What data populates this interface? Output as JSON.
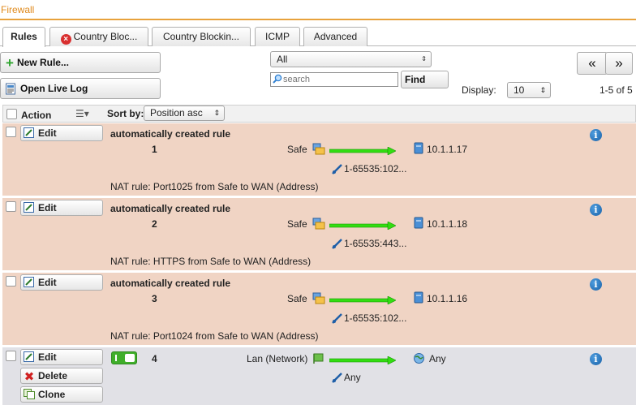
{
  "title": "Firewall",
  "tabs": [
    {
      "label": "Rules"
    },
    {
      "label": "Country Bloc..."
    },
    {
      "label": "Country Blockin..."
    },
    {
      "label": "ICMP"
    },
    {
      "label": "Advanced"
    }
  ],
  "toolbar": {
    "new_rule": "New Rule...",
    "open_live_log": "Open Live Log",
    "filter_value": "All",
    "search_placeholder": "search",
    "find": "Find",
    "display_label": "Display:",
    "display_value": "10",
    "pagination": "1-5 of 5",
    "prev": "«",
    "next": "»"
  },
  "table": {
    "action_header": "Action",
    "sort_label": "Sort by:",
    "sort_value": "Position asc"
  },
  "rules": [
    {
      "edit": "Edit",
      "title": "automatically created rule",
      "position": "1",
      "source": "Safe",
      "destination": "10.1.1.17",
      "service": "1-65535:102...",
      "note": "NAT rule: Port1025 from Safe to WAN (Address)"
    },
    {
      "edit": "Edit",
      "title": "automatically created rule",
      "position": "2",
      "source": "Safe",
      "destination": "10.1.1.18",
      "service": "1-65535:443...",
      "note": "NAT rule: HTTPS from Safe to WAN (Address)"
    },
    {
      "edit": "Edit",
      "title": "automatically created rule",
      "position": "3",
      "source": "Safe",
      "destination": "10.1.1.16",
      "service": "1-65535:102...",
      "note": "NAT rule: Port1024 from Safe to WAN (Address)"
    },
    {
      "edit": "Edit",
      "delete": "Delete",
      "clone": "Clone",
      "position": "4",
      "source": "Lan (Network)",
      "destination": "Any",
      "service": "Any"
    }
  ],
  "colors": {
    "accent": "#e08a1c",
    "nat_row": "#f0d4c4",
    "user_row": "#e1e1e6",
    "arrow": "#33dd11",
    "toggle_on": "#3fae2a"
  }
}
